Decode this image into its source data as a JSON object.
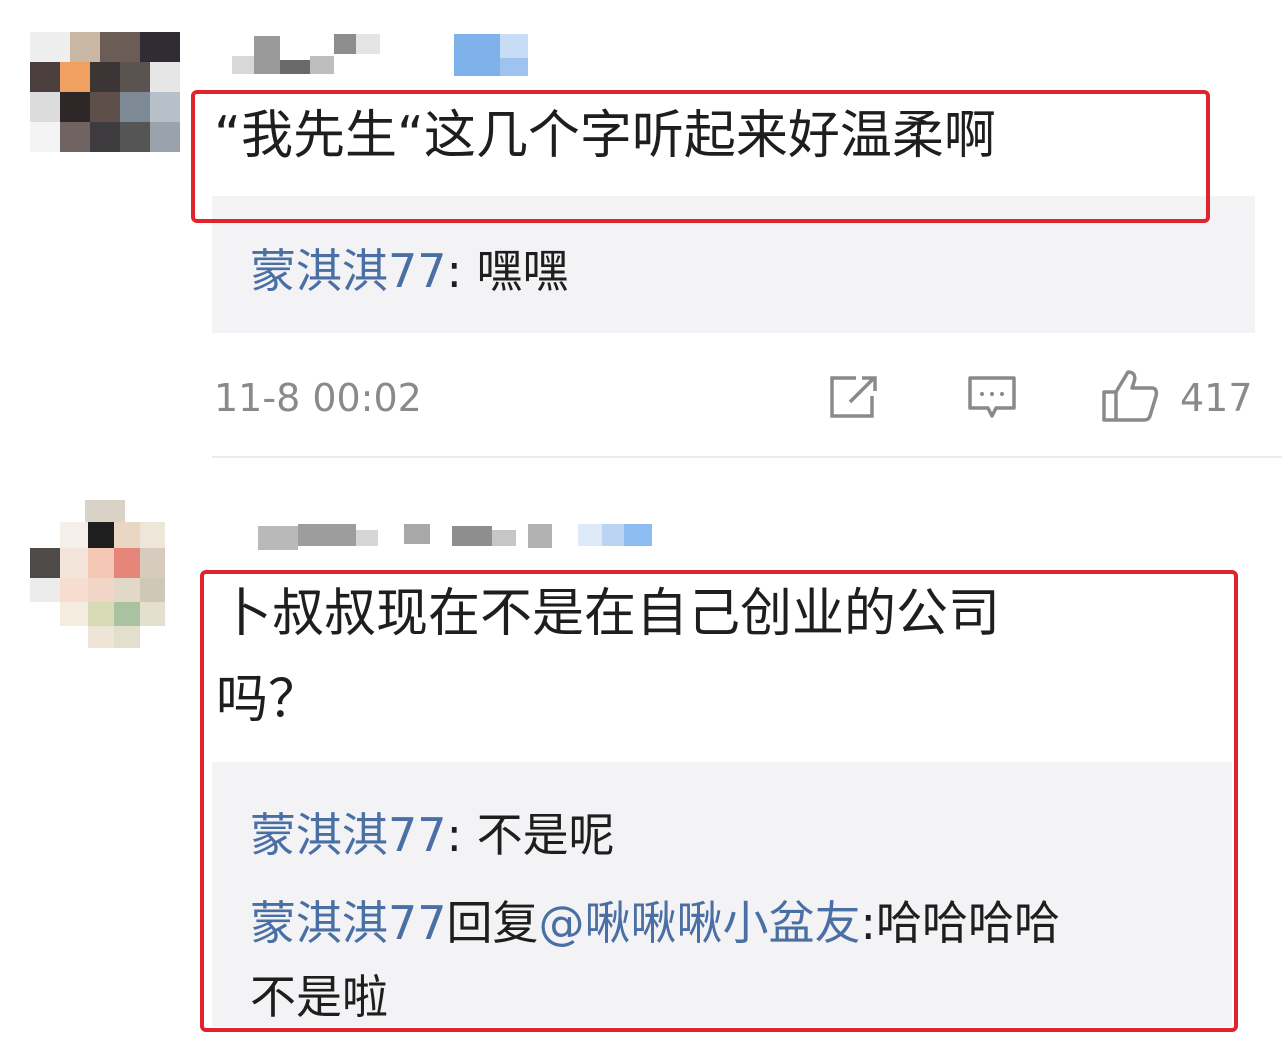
{
  "comments": [
    {
      "text": "“我先生“这几个字听起来好温柔啊",
      "replies": [
        {
          "user": "蒙淇淇77",
          "sep": ": ",
          "content": "嘿嘿"
        }
      ],
      "time": "11-8 00:02",
      "likes": "417"
    },
    {
      "text_line1": "卜叔叔现在不是在自己创业的公司",
      "text_line2": "吗？",
      "replies": [
        {
          "user": "蒙淇淇77",
          "sep": ": ",
          "content": "不是呢"
        },
        {
          "user": "蒙淇淇77",
          "mid": "回复",
          "mention": "@啾啾啾小盆友",
          "content_line1": ":哈哈哈哈",
          "content_line2": "不是啦"
        }
      ]
    }
  ],
  "colors": {
    "highlight": "#e0242c",
    "username": "#4a6fa5",
    "reply_bg": "#f3f3f5"
  },
  "icons": [
    "edit-icon",
    "comment-icon",
    "like-icon"
  ]
}
